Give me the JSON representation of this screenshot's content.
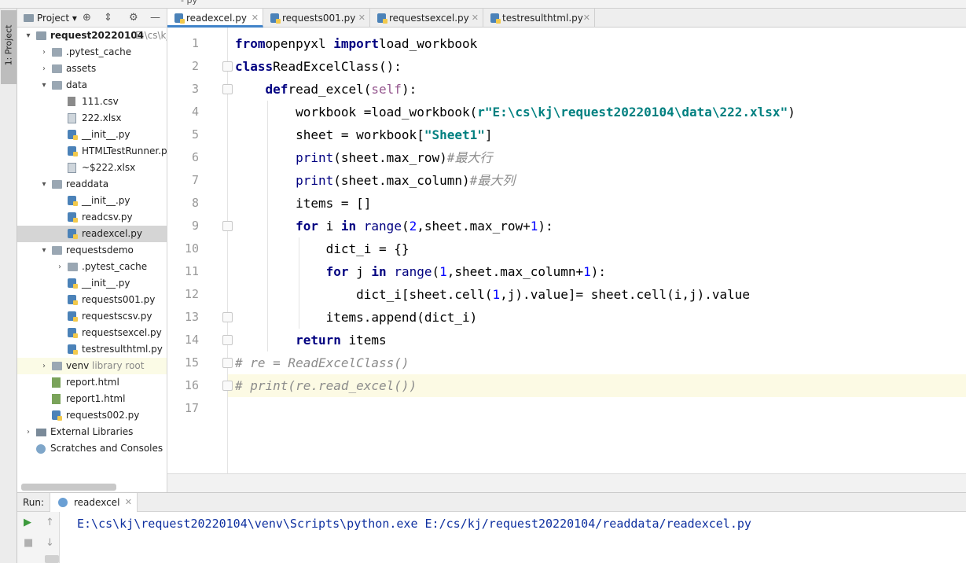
{
  "project_panel": {
    "title": "Project",
    "side_tab": "1: Project",
    "tree": [
      {
        "label": "request20220104",
        "suffix": "E:\\cs\\kj\\r",
        "type": "folder-root",
        "indent": 0,
        "arrow": "▾",
        "bold": true
      },
      {
        "label": ".pytest_cache",
        "type": "folder",
        "indent": 1,
        "arrow": "›"
      },
      {
        "label": "assets",
        "type": "folder",
        "indent": 1,
        "arrow": "›"
      },
      {
        "label": "data",
        "type": "folder",
        "indent": 1,
        "arrow": "▾"
      },
      {
        "label": "111.csv",
        "type": "csv",
        "indent": 2
      },
      {
        "label": "222.xlsx",
        "type": "xlsx",
        "indent": 2
      },
      {
        "label": "__init__.py",
        "type": "py",
        "indent": 2
      },
      {
        "label": "HTMLTestRunner.py",
        "type": "py",
        "indent": 2
      },
      {
        "label": "~$222.xlsx",
        "type": "xlsx",
        "indent": 2
      },
      {
        "label": "readdata",
        "type": "folder",
        "indent": 1,
        "arrow": "▾"
      },
      {
        "label": "__init__.py",
        "type": "py",
        "indent": 2
      },
      {
        "label": "readcsv.py",
        "type": "py",
        "indent": 2
      },
      {
        "label": "readexcel.py",
        "type": "py",
        "indent": 2,
        "selected": true
      },
      {
        "label": "requestsdemo",
        "type": "folder",
        "indent": 1,
        "arrow": "▾"
      },
      {
        "label": ".pytest_cache",
        "type": "folder",
        "indent": 2,
        "arrow": "›"
      },
      {
        "label": "__init__.py",
        "type": "py",
        "indent": 2
      },
      {
        "label": "requests001.py",
        "type": "py",
        "indent": 2
      },
      {
        "label": "requestscsv.py",
        "type": "py",
        "indent": 2
      },
      {
        "label": "requestsexcel.py",
        "type": "py",
        "indent": 2
      },
      {
        "label": "testresulthtml.py",
        "type": "py",
        "indent": 2
      },
      {
        "label": "venv",
        "suffix": "library root",
        "type": "folder",
        "indent": 1,
        "arrow": "›",
        "venv": true
      },
      {
        "label": "report.html",
        "type": "html",
        "indent": 1
      },
      {
        "label": "report1.html",
        "type": "html",
        "indent": 1
      },
      {
        "label": "requests002.py",
        "type": "py",
        "indent": 1
      },
      {
        "label": "External Libraries",
        "type": "lib",
        "indent": 0,
        "arrow": "›"
      },
      {
        "label": "Scratches and Consoles",
        "type": "scratch",
        "indent": 0
      }
    ]
  },
  "editor_tabs": [
    {
      "label": "readexcel.py",
      "active": true
    },
    {
      "label": "requests001.py",
      "active": false
    },
    {
      "label": "requestsexcel.py",
      "active": false
    },
    {
      "label": "testresulthtml.py",
      "active": false
    }
  ],
  "code": {
    "current_line": 16,
    "lines": [
      [
        [
          "kw",
          "from"
        ],
        [
          "",
          "openpyxl "
        ],
        [
          "kw",
          "import"
        ],
        [
          "",
          "load_workbook"
        ]
      ],
      [
        [
          "kw",
          "class"
        ],
        [
          "",
          "ReadExcelClass():"
        ]
      ],
      [
        [
          "",
          "    "
        ],
        [
          "kw",
          "def"
        ],
        [
          "",
          "read_excel("
        ],
        [
          "sf",
          "self"
        ],
        [
          "",
          "):"
        ]
      ],
      [
        [
          "",
          "        workbook =load_workbook("
        ],
        [
          "st",
          "r\"E:\\cs\\kj\\request20220104\\data\\222.xlsx\""
        ],
        [
          "",
          ")"
        ]
      ],
      [
        [
          "",
          "        sheet = workbook["
        ],
        [
          "st",
          "\"Sheet1\""
        ],
        [
          "",
          "]"
        ]
      ],
      [
        [
          "",
          "        "
        ],
        [
          "bi",
          "print"
        ],
        [
          "",
          "(sheet.max_row)"
        ],
        [
          "cm",
          "#最大行"
        ]
      ],
      [
        [
          "",
          "        "
        ],
        [
          "bi",
          "print"
        ],
        [
          "",
          "(sheet.max_column)"
        ],
        [
          "cm",
          "#最大列"
        ]
      ],
      [
        [
          "",
          "        items = []"
        ]
      ],
      [
        [
          "",
          "        "
        ],
        [
          "kw",
          "for"
        ],
        [
          "",
          " i "
        ],
        [
          "kw",
          "in"
        ],
        [
          "",
          " "
        ],
        [
          "bi",
          "range"
        ],
        [
          "",
          "("
        ],
        [
          "nm",
          "2"
        ],
        [
          "",
          ",sheet.max_row+"
        ],
        [
          "nm",
          "1"
        ],
        [
          "",
          "):"
        ]
      ],
      [
        [
          "",
          "            dict_i = {}"
        ]
      ],
      [
        [
          "",
          "            "
        ],
        [
          "kw",
          "for"
        ],
        [
          "",
          " j "
        ],
        [
          "kw",
          "in"
        ],
        [
          "",
          " "
        ],
        [
          "bi",
          "range"
        ],
        [
          "",
          "("
        ],
        [
          "nm",
          "1"
        ],
        [
          "",
          ",sheet.max_column+"
        ],
        [
          "nm",
          "1"
        ],
        [
          "",
          "):"
        ]
      ],
      [
        [
          "",
          "                dict_i[sheet.cell("
        ],
        [
          "nm",
          "1"
        ],
        [
          "",
          ",j).value]= sheet.cell(i,j).value"
        ]
      ],
      [
        [
          "",
          "            items.append(dict_i)"
        ]
      ],
      [
        [
          "",
          "        "
        ],
        [
          "kw",
          "return"
        ],
        [
          "",
          " items"
        ]
      ],
      [
        [
          "cm",
          "# re = ReadExcelClass()"
        ]
      ],
      [
        [
          "cm",
          "# print(re.read_excel())"
        ]
      ],
      [
        [
          "",
          ""
        ]
      ]
    ]
  },
  "run_panel": {
    "label": "Run:",
    "tab": "readexcel",
    "output": "E:\\cs\\kj\\request20220104\\venv\\Scripts\\python.exe E:/cs/kj/request20220104/readdata/readexcel.py"
  }
}
